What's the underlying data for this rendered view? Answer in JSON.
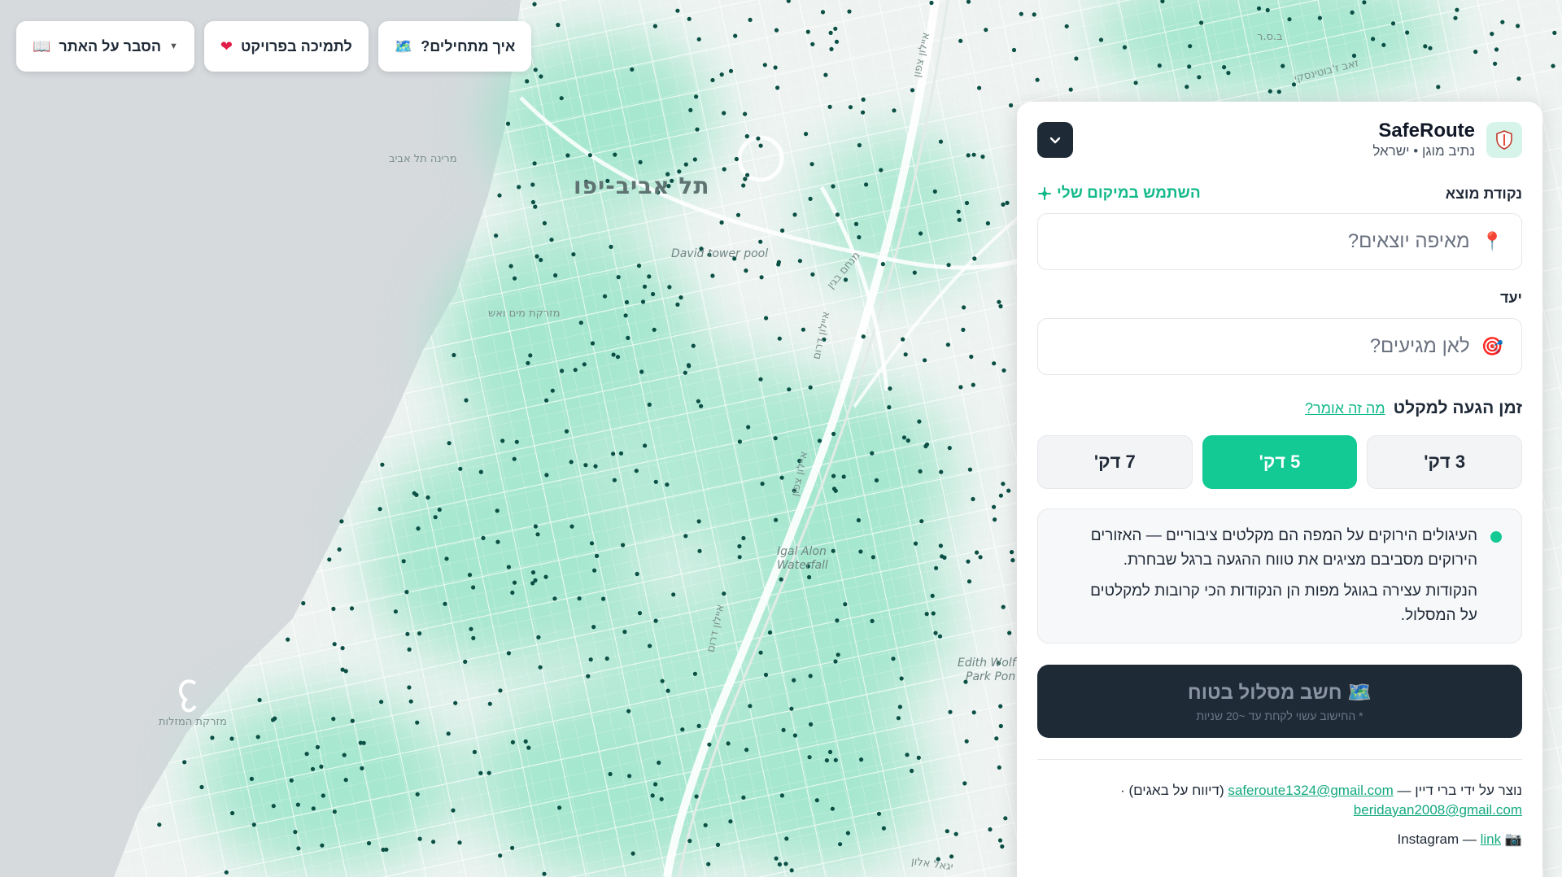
{
  "top_bar": {
    "explain_label": "הסבר על האתר",
    "support_label": "לתמיכה בפרויקט",
    "start_label": "איך מתחילים?"
  },
  "map": {
    "city": "תל אביב-יפו",
    "labels": {
      "marina": "מרינה תל אביב",
      "fountain": "מזרקת מים ואש",
      "zodiac": "מזרקת המזלות",
      "tower": "David tower pool",
      "waterfall_1": "Igal Alon",
      "waterfall_2": "Waterfall",
      "park_1": "Edith Wolf",
      "park_2": "Park Pon",
      "ayalon_1": "איילון צפון",
      "ayalon_2": "איילון דרום",
      "ayalon_3": "איילון צפון",
      "ayalon_4": "איילון דרום",
      "menachem": "מנחם בגין",
      "jabotinsky": "זאב ז'בוטינסקי",
      "bsr": "ב.ס.ר",
      "yigal": "יגאל אלון"
    },
    "colors": {
      "land": "#eef3f1",
      "sea": "#d6dadd",
      "heat": "#8fe3c4",
      "dot": "#0b4f45"
    }
  },
  "panel": {
    "brand_name": "SafeRoute",
    "brand_sub": "נתיב מוגן • ישראל",
    "origin_label": "נקודת מוצא",
    "use_location": "השתמש במיקום שלי",
    "origin_placeholder": "מאיפה יוצאים?",
    "dest_label": "יעד",
    "dest_placeholder": "לאן מגיעים?",
    "time_label": "זמן הגעה למקלט",
    "time_help": "מה זה אומר?",
    "options": [
      "3 דק'",
      "5 דק'",
      "7 דק'"
    ],
    "selected_option": "5 דק'",
    "info_p1": "העיגולים הירוקים על המפה הם מקלטים ציבוריים — האזורים הירוקים מסביבם מציגים את טווח ההגעה ברגל שבחרת.",
    "info_p2": "הנקודות עצירה בגוגל מפות הן הנקודות הכי קרובות למקלטים על המסלול.",
    "cta_title": "חשב מסלול בטוח",
    "cta_sub": "* החישוב עשוי לקחת עד ~20 שניות",
    "credits_prefix": "נוצר על ידי ברי דיין —",
    "email1": "saferoute1324@gmail.com",
    "credits_mid": "(דיווח על באגים) ·",
    "email2": "beridayan2008@gmail.com",
    "instagram_label": "Instagram —",
    "instagram_link": "link",
    "accent": "#13c994",
    "dark": "#1f2a37"
  }
}
